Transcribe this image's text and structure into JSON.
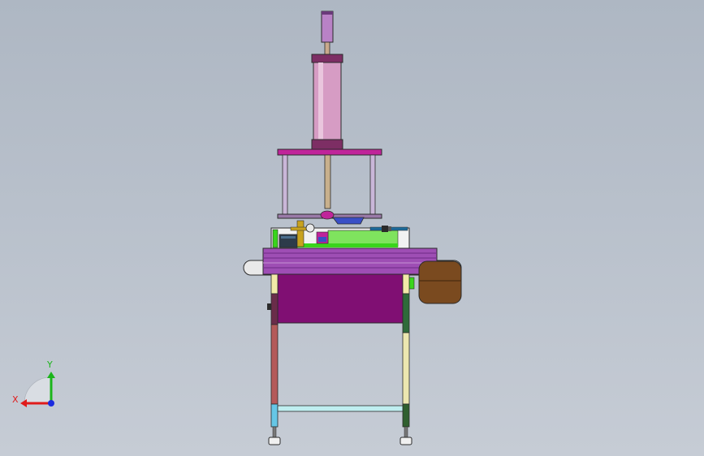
{
  "viewport": {
    "background_top": "#aeb7c3",
    "background_bottom": "#c6ccd5"
  },
  "colors": {
    "cylinder": "#c98fb3",
    "cylinder_cap": "#7d2e64",
    "plate_magenta": "#c0249a",
    "deck_green": "#39d51c",
    "body_purple": "#800f73",
    "conveyor_purple": "#9e4eb4",
    "roller_brown": "#7a4a1f",
    "frame_outline": "#2b2b2b",
    "leg_red": "#b45a5a",
    "leg_yellow": "#ece7b0",
    "leg_cyan": "#66c7e6",
    "crossbar_cyan": "#bfeef0",
    "fixture_blue": "#3a4fc6",
    "motor_dark": "#2d3b4a"
  },
  "triad": {
    "x_label": "X",
    "y_label": "Y",
    "x_color": "#e01b1b",
    "y_color": "#1bb51b",
    "z_color": "#1b2be0"
  }
}
